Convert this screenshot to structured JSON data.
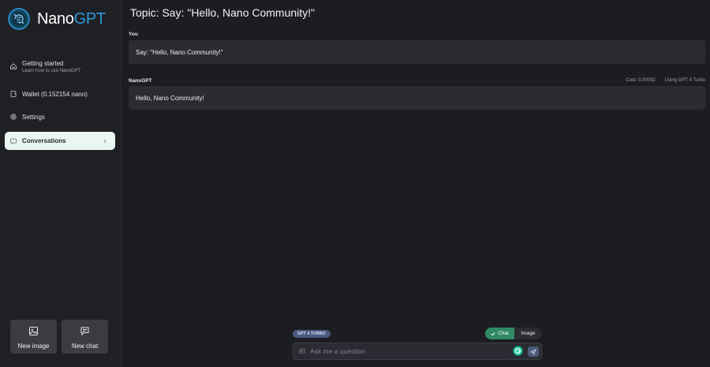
{
  "app": {
    "logo_text_main": "Nano",
    "logo_text_accent": "GPT"
  },
  "sidebar": {
    "items": [
      {
        "label": "Getting started",
        "sub": "Learn how to use NanoGPT",
        "icon": "home-icon"
      },
      {
        "label": "Wallet (0.152154 nano)",
        "icon": "wallet-icon"
      },
      {
        "label": "Settings",
        "icon": "gear-icon"
      },
      {
        "label": "Conversations",
        "icon": "message-icon",
        "active": true
      }
    ],
    "new_image_label": "New image",
    "new_chat_label": "New chat"
  },
  "conversation": {
    "topic": "Topic: Say: \"Hello, Nano Community!\"",
    "messages": [
      {
        "role": "You",
        "text": "Say: \"Hello, Nano Community!\""
      },
      {
        "role": "NanoGPT",
        "text": "Hello, Nano Community!",
        "cost": "Cost: 0.00092",
        "model_note": "Using GPT 4 Turbo"
      }
    ]
  },
  "composer": {
    "model_badge": "GPT 4 TURBO",
    "mode_chat": "Chat",
    "mode_image": "Image",
    "placeholder": "Ask me a question",
    "value": ""
  },
  "colors": {
    "background": "#1c1d21",
    "sidebar": "#1f2024",
    "active_item": "#e9f6f1",
    "accent_blue": "#2e9ae0",
    "chat_toggle": "#2f8a63",
    "model_badge": "#4a5a80"
  }
}
